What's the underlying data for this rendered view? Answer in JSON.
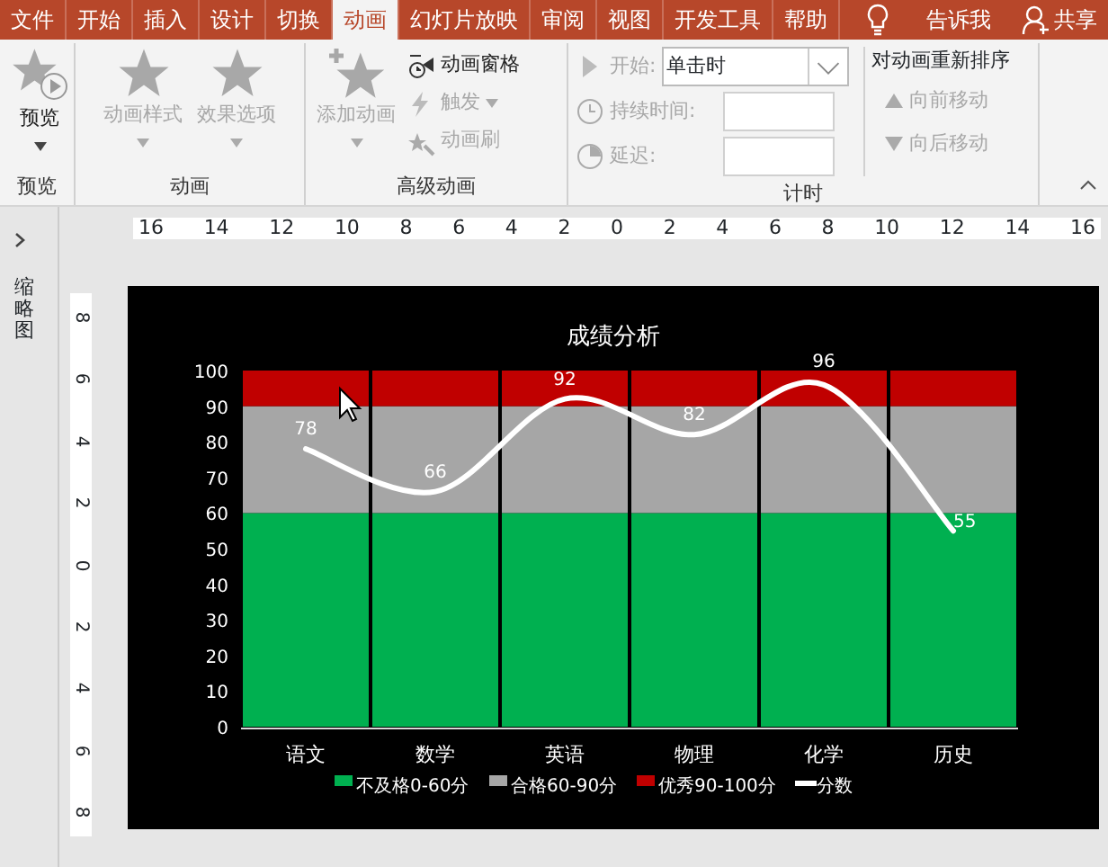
{
  "tabs": [
    {
      "label": "文件",
      "selected": false
    },
    {
      "label": "开始",
      "selected": false
    },
    {
      "label": "插入",
      "selected": false
    },
    {
      "label": "设计",
      "selected": false
    },
    {
      "label": "切换",
      "selected": false
    },
    {
      "label": "动画",
      "selected": true
    },
    {
      "label": "幻灯片放映",
      "selected": false
    },
    {
      "label": "审阅",
      "selected": false
    },
    {
      "label": "视图",
      "selected": false
    },
    {
      "label": "开发工具",
      "selected": false
    },
    {
      "label": "帮助",
      "selected": false
    }
  ],
  "tell_me": "告诉我",
  "share": "共享",
  "ribbon": {
    "preview": {
      "label": "预览",
      "button": {
        "label": "预览",
        "disabled": false,
        "dropdown": true
      }
    },
    "animation": {
      "label": "动画",
      "buttons": [
        {
          "label": "动画样式",
          "disabled": true,
          "dropdown": true
        },
        {
          "label": "效果选项",
          "disabled": true,
          "dropdown": true
        }
      ]
    },
    "advanced": {
      "label": "高级动画",
      "add": {
        "label": "添加动画",
        "disabled": true,
        "dropdown": true
      },
      "small_buttons": [
        {
          "label": "动画窗格",
          "disabled": false,
          "dropdown": false
        },
        {
          "label": "触发",
          "disabled": true,
          "dropdown": true
        },
        {
          "label": "动画刷",
          "disabled": true,
          "dropdown": false
        }
      ]
    },
    "timing": {
      "label": "计时",
      "start": {
        "label": "开始:",
        "value": "单击时",
        "disabled": true
      },
      "duration": {
        "label": "持续时间:",
        "disabled": true
      },
      "delay": {
        "label": "延迟:",
        "disabled": true
      },
      "reorder": {
        "title": "对动画重新排序",
        "buttons": [
          {
            "label": "向前移动",
            "disabled": true
          },
          {
            "label": "向后移动",
            "disabled": true
          }
        ]
      }
    }
  },
  "sidebar": {
    "title": "缩略图"
  },
  "ruler_h": [
    "16",
    "14",
    "12",
    "10",
    "8",
    "6",
    "4",
    "2",
    "0",
    "2",
    "4",
    "6",
    "8",
    "10",
    "12",
    "14",
    "16"
  ],
  "ruler_v": [
    "8",
    "6",
    "4",
    "2",
    "0",
    "2",
    "4",
    "6",
    "8"
  ],
  "slide": {
    "chart_data": {
      "type": "bar",
      "stacked": true,
      "legend": true,
      "title": "成绩分析",
      "categories": [
        "语文",
        "数学",
        "英语",
        "物理",
        "化学",
        "历史"
      ],
      "ylim": [
        0,
        100
      ],
      "yticks": [
        {
          "value": 0,
          "label": "0"
        },
        {
          "value": 10,
          "label": "10"
        },
        {
          "value": 20,
          "label": "20"
        },
        {
          "value": 30,
          "label": "30"
        },
        {
          "value": 40,
          "label": "40"
        },
        {
          "value": 50,
          "label": "50"
        },
        {
          "value": 60,
          "label": "60"
        },
        {
          "value": 70,
          "label": "70"
        },
        {
          "value": 80,
          "label": "80"
        },
        {
          "value": 90,
          "label": "90"
        },
        {
          "value": 100,
          "label": "100"
        }
      ],
      "series": [
        {
          "name": "不及格0-60分",
          "color": "#00b050",
          "values": [
            60,
            60,
            60,
            60,
            60,
            60
          ]
        },
        {
          "name": "合格60-90分",
          "color": "#a6a6a6",
          "values": [
            30,
            30,
            30,
            30,
            30,
            30
          ]
        },
        {
          "name": "优秀90-100分",
          "color": "#c00000",
          "values": [
            10,
            10,
            10,
            10,
            10,
            10
          ]
        },
        {
          "name": "分数",
          "color": "#ffffff",
          "type": "line",
          "data_labels": true,
          "values": [
            78,
            66,
            92,
            82,
            96,
            55
          ]
        }
      ]
    }
  }
}
